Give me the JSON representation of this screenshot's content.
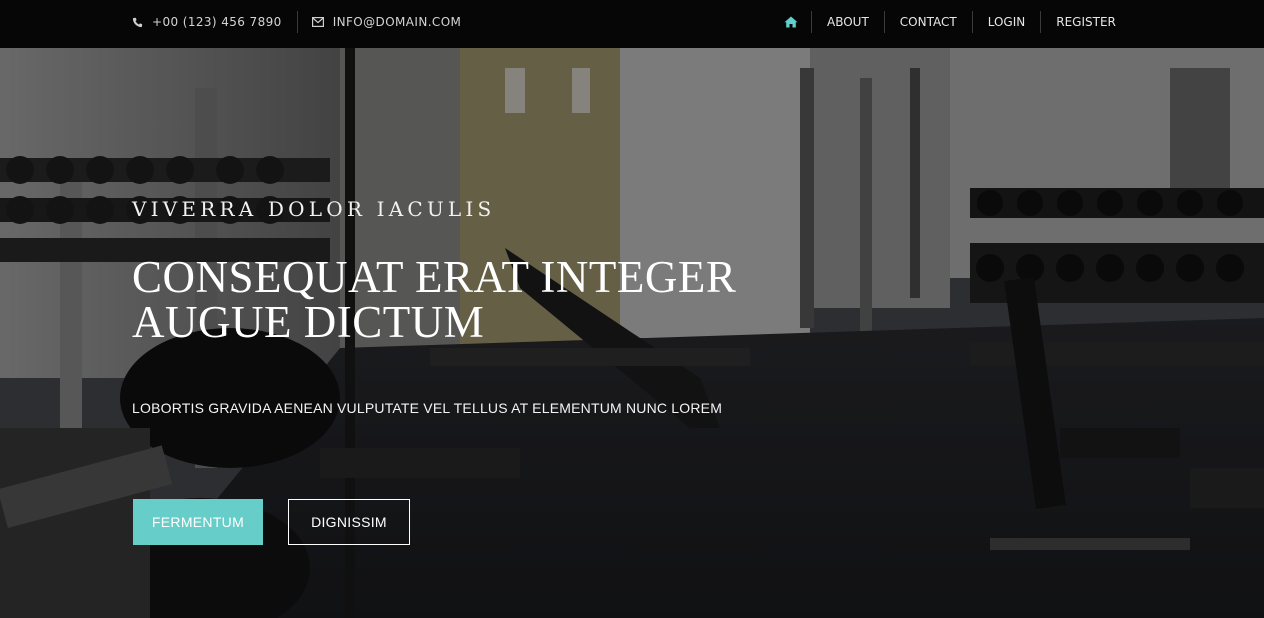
{
  "topbar": {
    "phone": "+00 (123) 456 7890",
    "email": "INFO@DOMAIN.COM",
    "phone_icon": "phone-icon",
    "email_icon": "envelope-icon"
  },
  "nav": {
    "home_icon": "home-icon",
    "items": [
      {
        "label": "ABOUT"
      },
      {
        "label": "CONTACT"
      },
      {
        "label": "LOGIN"
      },
      {
        "label": "REGISTER"
      }
    ]
  },
  "hero": {
    "eyebrow": "VIVERRA DOLOR IACULIS",
    "headline_line1": "CONSEQUAT ERAT INTEGER",
    "headline_line2": "AUGUE DICTUM",
    "subline": "LOBORTIS GRAVIDA AENEAN VULPUTATE VEL TELLUS AT ELEMENTUM NUNC LOREM",
    "primary_button": "FERMENTUM",
    "secondary_button": "DIGNISSIM"
  },
  "colors": {
    "accent": "#66cdc8",
    "topbar_bg": "#060606",
    "home_icon": "#5fd0cc"
  }
}
